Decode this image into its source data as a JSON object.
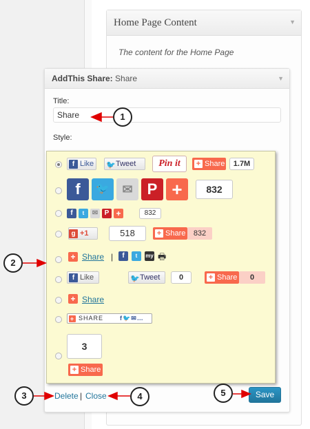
{
  "home_widget": {
    "title": "Home Page Content",
    "description": "The content for the Home Page"
  },
  "widget": {
    "title_bold": "AddThis Share:",
    "title_sub": " Share",
    "title_label": "Title:",
    "title_value": "Share",
    "style_label": "Style:",
    "styles": [
      {
        "like": "Like",
        "tweet": "Tweet",
        "pinit": "Pin it",
        "share": "Share",
        "count": "1.7M",
        "selected": true
      },
      {
        "count": "832"
      },
      {
        "count": "832"
      },
      {
        "plusone": "+1",
        "count1": "518",
        "share": "Share",
        "count2": "832"
      },
      {
        "share": "Share",
        "separator": "|",
        "myspace": "my"
      },
      {
        "like": "Like",
        "tweet": "Tweet",
        "tweet_count": "0",
        "share": "Share",
        "share_count": "0"
      },
      {
        "share": "Share"
      },
      {
        "share": "SHARE"
      },
      {
        "count": "3",
        "share": "Share"
      }
    ],
    "delete_label": "Delete",
    "sep": " | ",
    "close_label": "Close",
    "save_label": "Save"
  },
  "callouts": [
    "1",
    "2",
    "3",
    "4",
    "5"
  ],
  "colors": {
    "accent": "#21759b",
    "share_orange": "#f8694d",
    "style_bg": "#fcfad2",
    "callout_arrow": "#e00000"
  }
}
